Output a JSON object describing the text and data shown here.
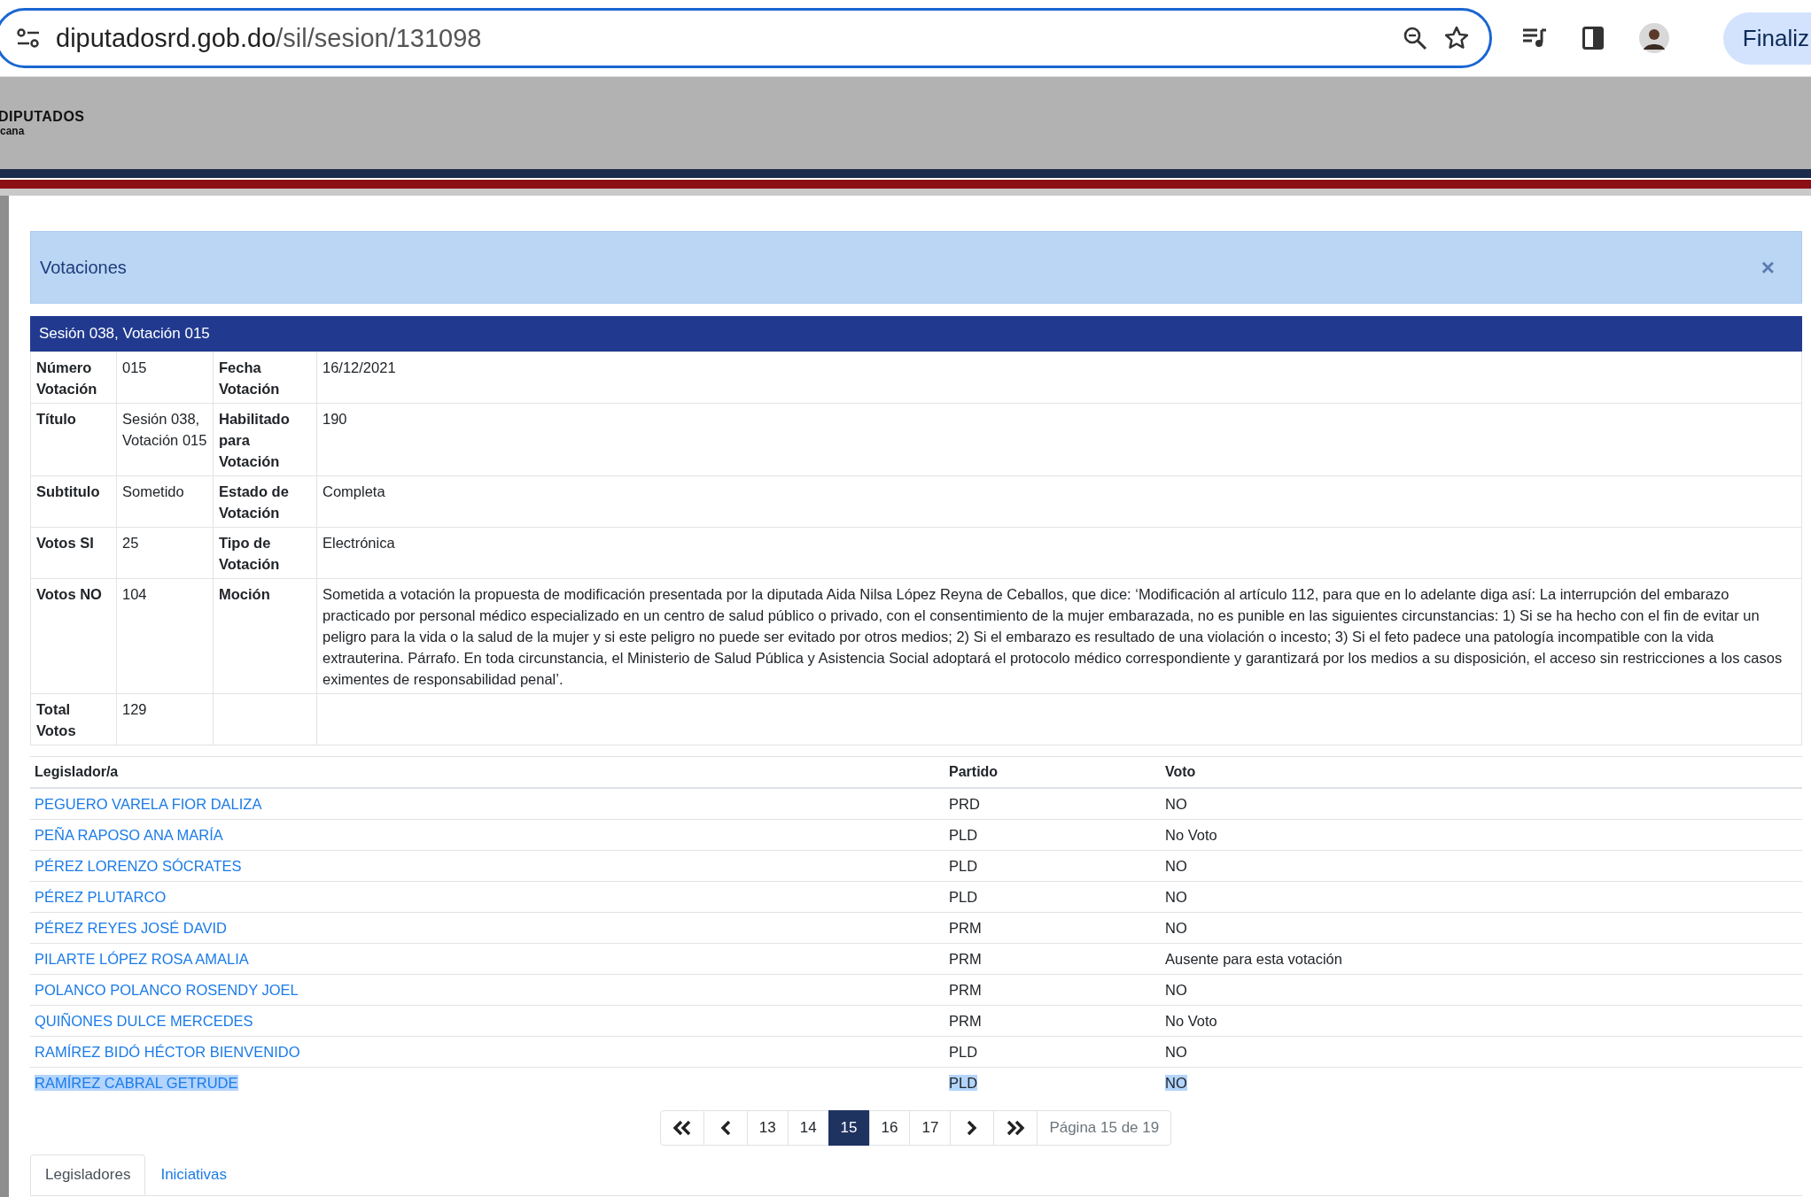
{
  "browser": {
    "url_host": "diputadosrd.gob.do",
    "url_path": "/sil/sesion/131098",
    "button": "Finaliz"
  },
  "site_header": {
    "logo_title": "DIPUTADOS",
    "logo_subtitle": "cana"
  },
  "modal": {
    "title": "Votaciones",
    "close": "×",
    "session_bar": "Sesión 038, Votación 015",
    "details": [
      {
        "label1": "Número Votación",
        "value1": "015",
        "label2": "Fecha Votación",
        "value2": "16/12/2021"
      },
      {
        "label1": "Título",
        "value1": "Sesión 038, Votación 015",
        "label2": "Habilitado para Votación",
        "value2": "190"
      },
      {
        "label1": "Subtitulo",
        "value1": "Sometido",
        "label2": "Estado de Votación",
        "value2": "Completa"
      },
      {
        "label1": "Votos SI",
        "value1": "25",
        "label2": "Tipo de Votación",
        "value2": "Electrónica"
      },
      {
        "label1": "Votos NO",
        "value1": "104",
        "label2": "Moción",
        "value2": "Sometida a votación la propuesta de modificación presentada por la diputada Aida Nilsa López Reyna de Ceballos, que dice: ‘Modificación al artículo 112, para que en lo adelante diga así: La interrupción del embarazo practicado por personal médico especializado en un centro de salud público o privado, con el consentimiento de la mujer embarazada, no es punible en las siguientes circunstancias: 1) Si se ha hecho con el fin de evitar un peligro para la vida o la salud de la mujer y si este peligro no puede ser evitado por otros medios; 2) Si el embarazo es resultado de una violación o incesto; 3) Si el feto padece una patología incompatible con la vida extrauterina. Párrafo. En toda circunstancia, el Ministerio de Salud Pública y Asistencia Social adoptará el protocolo médico correspondiente y garantizará por los medios a su disposición, el acceso sin restricciones a los casos eximentes de responsabilidad penal’."
      },
      {
        "label1": "Total Votos",
        "value1": "129"
      }
    ],
    "votes": {
      "columns": [
        "Legislador/a",
        "Partido",
        "Voto"
      ],
      "rows": [
        {
          "name": "PEGUERO VARELA FIOR DALIZA",
          "party": "PRD",
          "vote": "NO",
          "highlighted": false
        },
        {
          "name": "PEÑA RAPOSO ANA MARÍA",
          "party": "PLD",
          "vote": "No Voto",
          "highlighted": false
        },
        {
          "name": "PÉREZ LORENZO SÓCRATES",
          "party": "PLD",
          "vote": "NO",
          "highlighted": false
        },
        {
          "name": "PÉREZ PLUTARCO",
          "party": "PLD",
          "vote": "NO",
          "highlighted": false
        },
        {
          "name": "PÉREZ REYES JOSÉ DAVID",
          "party": "PRM",
          "vote": "NO",
          "highlighted": false
        },
        {
          "name": "PILARTE LÓPEZ ROSA AMALIA",
          "party": "PRM",
          "vote": "Ausente para esta votación",
          "highlighted": false
        },
        {
          "name": "POLANCO POLANCO ROSENDY JOEL",
          "party": "PRM",
          "vote": "NO",
          "highlighted": false
        },
        {
          "name": "QUIÑONES DULCE MERCEDES",
          "party": "PRM",
          "vote": "No Voto",
          "highlighted": false
        },
        {
          "name": "RAMÍREZ BIDÓ HÉCTOR BIENVENIDO",
          "party": "PLD",
          "vote": "NO",
          "highlighted": false
        },
        {
          "name": "RAMÍREZ CABRAL GETRUDE",
          "party": "PLD",
          "vote": "NO",
          "highlighted": true
        }
      ]
    },
    "pagination": [
      {
        "kind": "first",
        "selected": false
      },
      {
        "kind": "prev",
        "selected": false
      },
      {
        "kind": "page",
        "label": "13",
        "selected": false
      },
      {
        "kind": "page",
        "label": "14",
        "selected": false
      },
      {
        "kind": "page",
        "label": "15",
        "selected": true
      },
      {
        "kind": "page",
        "label": "16",
        "selected": false
      },
      {
        "kind": "page",
        "label": "17",
        "selected": false
      },
      {
        "kind": "next",
        "selected": false
      },
      {
        "kind": "last",
        "selected": false
      },
      {
        "kind": "info",
        "label": "Página 15 de 19",
        "selected": false
      }
    ],
    "tabs": [
      {
        "label": "Legisladores",
        "selected": true
      },
      {
        "label": "Iniciativas",
        "selected": false
      }
    ]
  }
}
